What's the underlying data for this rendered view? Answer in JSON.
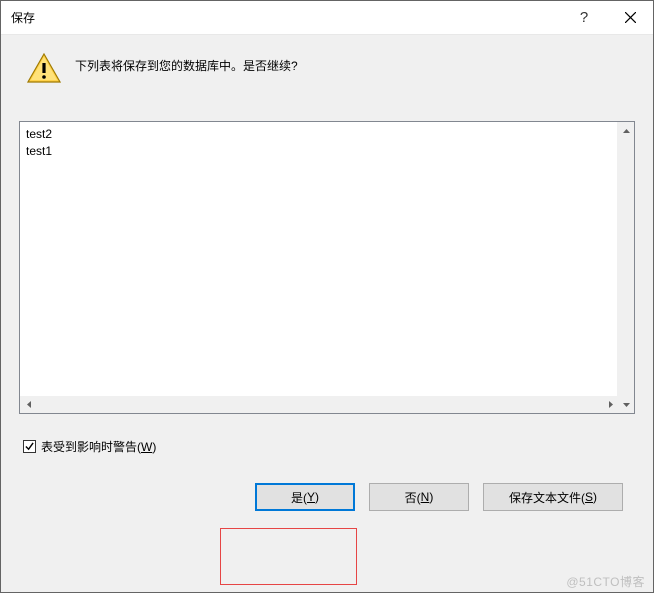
{
  "titlebar": {
    "title": "保存",
    "help": "?",
    "close": "×"
  },
  "message": {
    "text": "下列表将保存到您的数据库中。是否继续?"
  },
  "tables": {
    "items": [
      "test2",
      "test1"
    ]
  },
  "checkbox": {
    "checked": true,
    "label_prefix": "表受到影响时警告(",
    "label_hotkey": "W",
    "label_suffix": ")"
  },
  "buttons": {
    "yes_prefix": "是(",
    "yes_hotkey": "Y",
    "yes_suffix": ")",
    "no_prefix": "否(",
    "no_hotkey": "N",
    "no_suffix": ")",
    "save_prefix": "保存文本文件(",
    "save_hotkey": "S",
    "save_suffix": ")"
  },
  "watermark": "@51CTO博客"
}
